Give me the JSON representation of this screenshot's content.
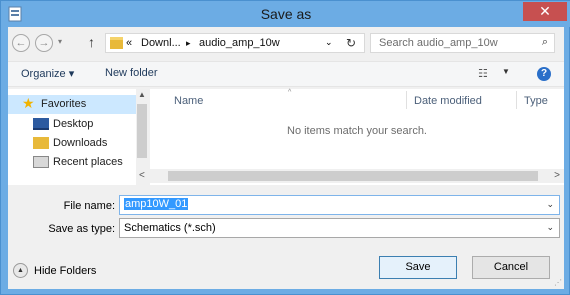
{
  "window": {
    "title": "Save as",
    "close_glyph": "✕"
  },
  "nav": {
    "back_glyph": "←",
    "forward_glyph": "→",
    "recent_glyph": "▾",
    "up_glyph": "↑",
    "breadcrumb_prefix": "«",
    "breadcrumbs": [
      "Downl...",
      "audio_amp_10w"
    ],
    "separator_glyph": "▸",
    "dropdown_glyph": "⌄",
    "refresh_glyph": "↻"
  },
  "search": {
    "placeholder": "Search audio_amp_10w",
    "icon_glyph": "⌕"
  },
  "toolbar": {
    "organize_label": "Organize ▾",
    "new_folder_label": "New folder",
    "view_glyph": "☷",
    "view_drop_glyph": "▼",
    "help_glyph": "?"
  },
  "sidebar": {
    "items": [
      {
        "label": "Favorites",
        "icon": "star-icon",
        "glyph": "★"
      },
      {
        "label": "Desktop",
        "icon": "desktop-icon"
      },
      {
        "label": "Downloads",
        "icon": "downloads-folder-icon"
      },
      {
        "label": "Recent places",
        "icon": "recent-places-icon"
      }
    ],
    "scroll_up_glyph": "▲"
  },
  "file_list": {
    "columns": [
      "Name",
      "Date modified",
      "Type"
    ],
    "sort_glyph": "^",
    "empty_message": "No items match your search."
  },
  "hscroll": {
    "left_glyph": "<",
    "right_glyph": ">"
  },
  "form": {
    "file_name_label": "File name:",
    "file_name_value": "amp10W_01",
    "save_type_label": "Save as type:",
    "save_type_value": "Schematics (*.sch)",
    "dropdown_glyph": "⌄"
  },
  "footer": {
    "hide_folders_label": "Hide Folders",
    "hide_folders_glyph": "▲",
    "save_label": "Save",
    "cancel_label": "Cancel"
  },
  "colors": {
    "title_bar": "#6cace4",
    "close_button": "#c75050",
    "selection": "#3399ff",
    "sidebar_selected": "#cce8ff"
  }
}
